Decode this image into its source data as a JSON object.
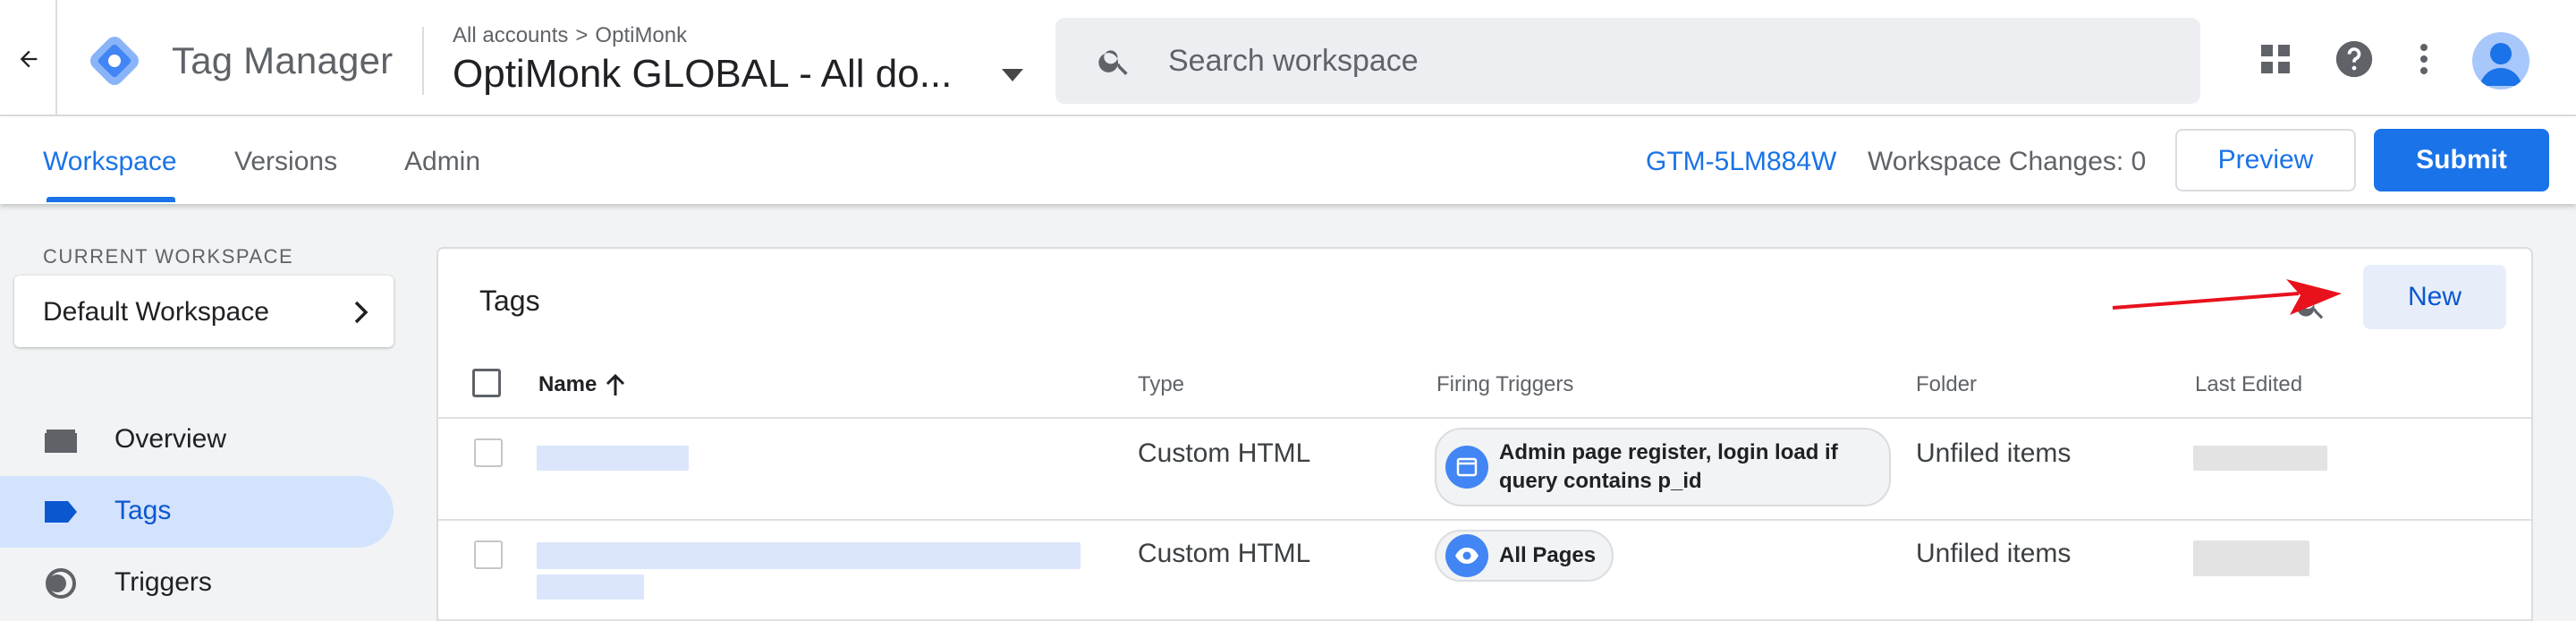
{
  "header": {
    "back_icon": "arrow-left-icon",
    "product_name": "Tag Manager",
    "breadcrumb": {
      "account": "All accounts",
      "separator": ">",
      "container": "OptiMonk"
    },
    "container_name": "OptiMonk GLOBAL - All do...",
    "search": {
      "placeholder": "Search workspace"
    },
    "icons": [
      "apps-grid-icon",
      "help-icon",
      "more-vert-icon",
      "account-avatar-icon"
    ]
  },
  "subnav": {
    "tabs": [
      {
        "label": "Workspace",
        "active": true
      },
      {
        "label": "Versions",
        "active": false
      },
      {
        "label": "Admin",
        "active": false
      }
    ],
    "container_id": "GTM-5LM884W",
    "workspace_changes": "Workspace Changes: 0",
    "preview_label": "Preview",
    "submit_label": "Submit"
  },
  "sidebar": {
    "current_workspace_caption": "CURRENT WORKSPACE",
    "workspace_name": "Default Workspace",
    "items": [
      {
        "label": "Overview",
        "icon": "briefcase-icon",
        "active": false
      },
      {
        "label": "Tags",
        "icon": "tag-icon",
        "active": true
      },
      {
        "label": "Triggers",
        "icon": "trigger-icon",
        "active": false
      }
    ]
  },
  "tags_panel": {
    "title": "Tags",
    "new_label": "New",
    "columns": {
      "name": "Name",
      "type": "Type",
      "triggers": "Firing Triggers",
      "folder": "Folder",
      "last_edited": "Last Edited"
    },
    "rows": [
      {
        "type": "Custom HTML",
        "trigger": "Admin page register, login load if query contains p_id",
        "trigger_icon": "window-icon",
        "folder": "Unfiled items"
      },
      {
        "type": "Custom HTML",
        "trigger": "All Pages",
        "trigger_icon": "eye-icon",
        "folder": "Unfiled items"
      }
    ]
  },
  "colors": {
    "accent": "#1a73e8",
    "active_nav_bg": "#d3e3fd",
    "annotation_arrow": "#e8121c"
  }
}
